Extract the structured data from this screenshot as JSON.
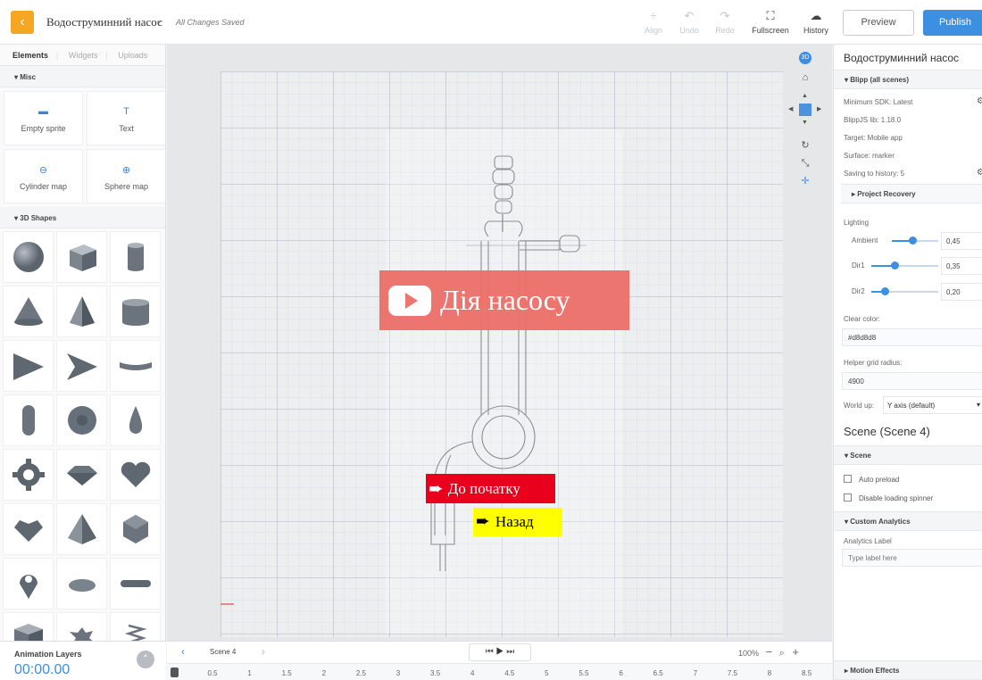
{
  "header": {
    "back_icon": "chevron-left-icon",
    "project_title": "Водоструминний насос",
    "save_status": "All Changes Saved",
    "tools": [
      {
        "label": "Align",
        "icon": "align-icon",
        "enabled": false
      },
      {
        "label": "Undo",
        "icon": "undo-icon",
        "enabled": false
      },
      {
        "label": "Redo",
        "icon": "redo-icon",
        "enabled": false
      },
      {
        "label": "Fullscreen",
        "icon": "fullscreen-icon",
        "enabled": true
      },
      {
        "label": "History",
        "icon": "cloud-icon",
        "enabled": true
      }
    ],
    "preview_label": "Preview",
    "publish_label": "Publish",
    "accent_color": "#3d8fe0",
    "back_color": "#f5a623"
  },
  "left": {
    "tabs": [
      "Elements",
      "Widgets",
      "Uploads"
    ],
    "misc_heading": "Misc",
    "misc_items": [
      "Empty sprite",
      "Text",
      "Cylinder map",
      "Sphere map"
    ],
    "shapes_heading": "3D Shapes",
    "shapes": [
      "sphere",
      "cube",
      "cylinder",
      "cone",
      "tetrahedron",
      "tube",
      "triangle",
      "arrow",
      "curved-plane",
      "capsule",
      "disc",
      "drop",
      "gear",
      "gem",
      "heart",
      "heart-gem",
      "pyramid",
      "icosahedron",
      "pin",
      "lens",
      "rod",
      "box",
      "splat",
      "spring"
    ],
    "animation_label": "Animation Layers",
    "animation_time": "00:00.00"
  },
  "canvas": {
    "play_button_label": "Дія насосу",
    "home_button_label": "До початку",
    "back_button_label": "Назад",
    "play_button_color": "#ec7068",
    "home_button_color": "#e8001c",
    "back_button_color": "#ffff00",
    "view_badge": "3D"
  },
  "timeline": {
    "scene_label": "Scene 4",
    "zoom": "100%",
    "ticks": [
      "0.5",
      "1",
      "1.5",
      "2",
      "2.5",
      "3",
      "3.5",
      "4",
      "4.5",
      "5",
      "5.5",
      "6",
      "6.5",
      "7",
      "7.5",
      "8",
      "8.5"
    ]
  },
  "right": {
    "title": "Водоструминний насос",
    "blipp_section": "Blipp (all scenes)",
    "min_sdk": "Minimum SDK: Latest",
    "blippjs": "BlippJS lib: 1.18.0",
    "target": "Target: Mobile app",
    "surface": "Surface: marker",
    "saving": "Saving to history: 5",
    "project_recovery": "Project Recovery",
    "lighting_label": "Lighting",
    "lights": [
      {
        "label": "Ambient",
        "value": "0,45",
        "fraction": 0.45
      },
      {
        "label": "Dir1",
        "value": "0,35",
        "fraction": 0.35
      },
      {
        "label": "Dir2",
        "value": "0,20",
        "fraction": 0.2
      }
    ],
    "clear_color_label": "Clear color:",
    "clear_color": "#d8d8d8",
    "helper_grid_label": "Helper grid radius:",
    "helper_grid": "4900",
    "world_up_label": "World up:",
    "world_up": "Y axis (default)",
    "scene_title": "Scene (Scene 4)",
    "scene_section": "Scene",
    "auto_preload": "Auto preload",
    "disable_spinner": "Disable loading spinner",
    "custom_analytics": "Custom Analytics",
    "analytics_label": "Analytics Label",
    "analytics_placeholder": "Type label here",
    "motion_effects": "Motion Effects"
  }
}
